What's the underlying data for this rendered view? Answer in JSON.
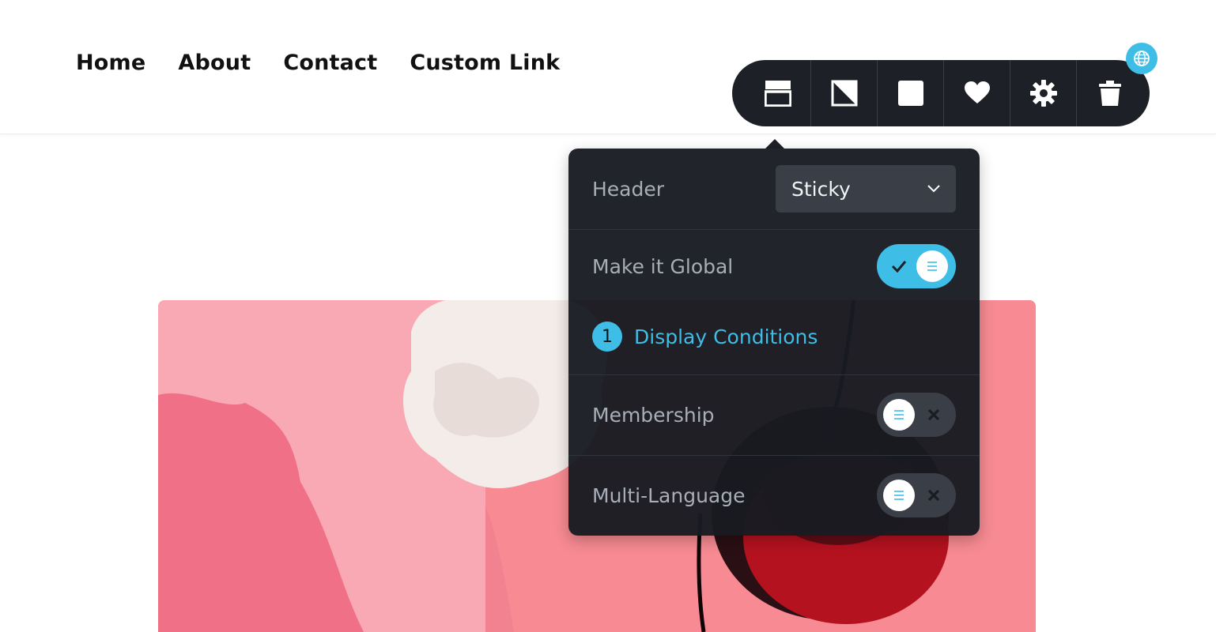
{
  "nav": {
    "items": [
      "Home",
      "About",
      "Contact",
      "Custom Link"
    ]
  },
  "toolbar": {
    "tools": [
      {
        "icon": "header-layout-icon"
      },
      {
        "icon": "contrast-icon"
      },
      {
        "icon": "square-icon"
      },
      {
        "icon": "heart-icon"
      },
      {
        "icon": "gear-icon"
      },
      {
        "icon": "trash-icon"
      }
    ],
    "badge_icon": "globe-icon"
  },
  "panel": {
    "header_label": "Header",
    "header_select_value": "Sticky",
    "global_label": "Make it Global",
    "global_enabled": true,
    "conditions_count": "1",
    "conditions_label": "Display Conditions",
    "membership_label": "Membership",
    "membership_enabled": false,
    "multilang_label": "Multi-Language",
    "multilang_enabled": false
  },
  "colors": {
    "accent": "#3ebde6",
    "toolbar_bg": "#1d2026",
    "panel_bg": "#181b21",
    "hero_pink": "#f7a2ae"
  }
}
